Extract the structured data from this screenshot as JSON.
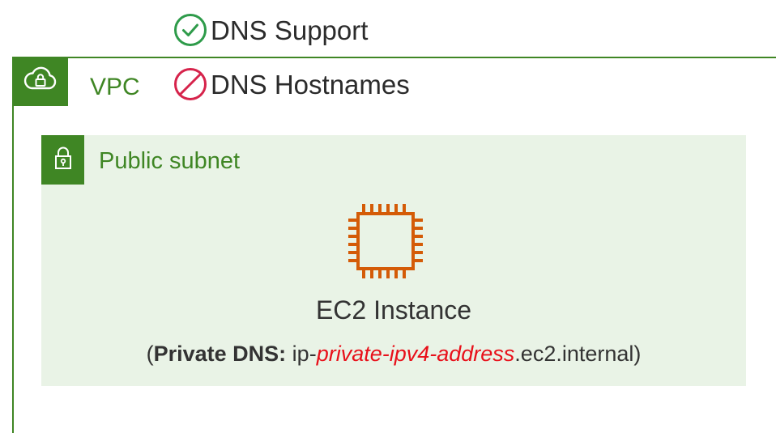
{
  "dns_options": {
    "support": {
      "label": "DNS Support",
      "icon": "check-circle-icon",
      "status": "enabled",
      "color": "#2e9b4a"
    },
    "hostnames": {
      "label": "DNS Hostnames",
      "icon": "prohibited-icon",
      "status": "disabled",
      "color": "#d6234b"
    }
  },
  "vpc": {
    "label": "VPC",
    "icon": "cloud-lock-icon",
    "color": "#3f8624"
  },
  "subnet": {
    "label": "Public subnet",
    "icon": "lock-icon",
    "fill": "#e9f3e6"
  },
  "instance": {
    "icon": "ec2-chip-icon",
    "icon_color": "#d45b07",
    "title": "EC2 Instance",
    "dns": {
      "open_paren": "(",
      "label": "Private DNS:",
      "prefix": " ip-",
      "variable": "private-ipv4-address",
      "suffix": ".ec2.internal",
      "close_paren": ")",
      "variable_color": "#e8101a"
    }
  }
}
